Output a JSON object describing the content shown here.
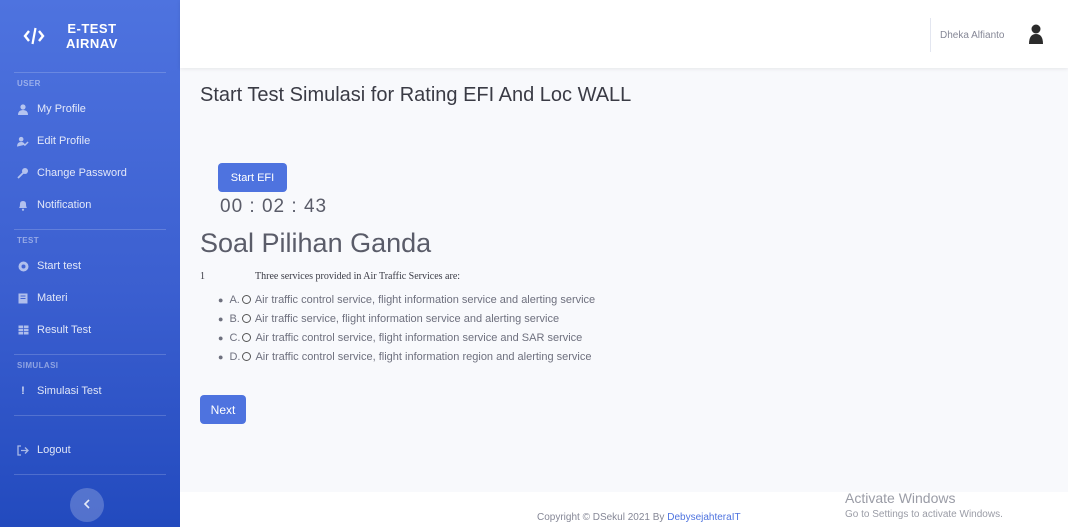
{
  "sidebar": {
    "brand_line1": "E-TEST",
    "brand_line2": "AIRNAV",
    "sections": {
      "user": "USER",
      "test": "TEST",
      "simulasi": "SIMULASI"
    },
    "items": [
      {
        "label": "My Profile",
        "icon": "user-icon"
      },
      {
        "label": "Edit Profile",
        "icon": "user-edit-icon"
      },
      {
        "label": "Change Password",
        "icon": "key-icon"
      },
      {
        "label": "Notification",
        "icon": "bell-icon"
      },
      {
        "label": "Start test",
        "icon": "target-icon"
      },
      {
        "label": "Materi",
        "icon": "book-icon"
      },
      {
        "label": "Result Test",
        "icon": "table-icon"
      },
      {
        "label": "Simulasi Test",
        "icon": "exclamation-icon"
      },
      {
        "label": "Logout",
        "icon": "logout-icon"
      }
    ]
  },
  "topbar": {
    "user_name": "Dheka Alfianto"
  },
  "main": {
    "title": "Start Test Simulasi for Rating EFI And Loc WALL",
    "start_button": "Start EFI",
    "timer": "00 : 02 : 43",
    "section_title": "Soal Pilihan Ganda",
    "question": {
      "number": "1",
      "text": "Three services provided in Air Traffic Services are:",
      "options": [
        {
          "letter": "A.",
          "text": "Air traffic control service, flight information service and alerting service"
        },
        {
          "letter": "B.",
          "text": "Air traffic service, flight information service and alerting service"
        },
        {
          "letter": "C.",
          "text": "Air traffic control service, flight information service and SAR service"
        },
        {
          "letter": "D.",
          "text": "Air traffic control service, flight information region and alerting service"
        }
      ]
    },
    "next_button": "Next"
  },
  "footer": {
    "copyright": "Copyright © DSekul 2021 By ",
    "link": "DebysejahteraIT"
  },
  "windows_watermark": {
    "title": "Activate Windows",
    "subtitle": "Go to Settings to activate Windows."
  },
  "colors": {
    "accent": "#4e73df",
    "sidebar_dark": "#224abe"
  }
}
